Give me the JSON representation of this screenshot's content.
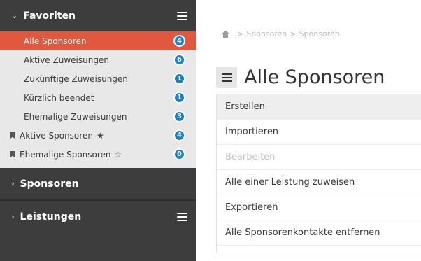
{
  "sidebar": {
    "favoriten": {
      "header": "Favoriten",
      "icon": "chevron-down-icon",
      "items": [
        {
          "label": "Alle Sponsoren",
          "count": "4",
          "active": true
        },
        {
          "label": "Aktive Zuweisungen",
          "count": "6"
        },
        {
          "label": "Zukünftige Zuweisungen",
          "count": "1"
        },
        {
          "label": "Kürzlich beendet",
          "count": "1"
        },
        {
          "label": "Ehemalige Zuweisungen",
          "count": "3"
        },
        {
          "label": "Aktive Sponsoren",
          "count": "4",
          "pinned": true,
          "star": "★"
        },
        {
          "label": "Ehemalige Sponsoren",
          "count": "0",
          "pinned": true,
          "star": "☆"
        }
      ]
    },
    "sponsoren": {
      "header": "Sponsoren"
    },
    "leistungen": {
      "header": "Leistungen"
    }
  },
  "breadcrumb": {
    "items": [
      "Sponsoren",
      "Sponsoren"
    ],
    "separator": ">"
  },
  "main": {
    "title": "Alle Sponsoren",
    "menu_items": [
      {
        "label": "Erstellen"
      },
      {
        "label": "Importieren"
      },
      {
        "label": "Bearbeiten",
        "disabled": true
      },
      {
        "label": "Alle einer Leistung zuweisen"
      },
      {
        "label": "Exportieren"
      },
      {
        "label": "Alle Sponsorenkontakte entfernen"
      }
    ]
  },
  "colors": {
    "sidebar_bg": "#3d3d3d",
    "active_item": "#e2583e",
    "badge": "#1a7fd1",
    "list_bg": "#e8e8e8"
  }
}
